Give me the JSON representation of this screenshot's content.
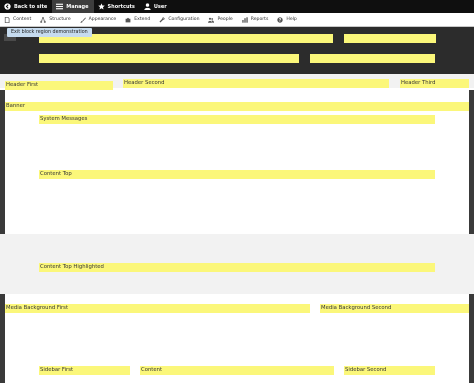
{
  "toolbar": {
    "items": [
      {
        "label": "Back to site",
        "icon": "back-arrow-icon"
      },
      {
        "label": "Manage",
        "icon": "hamburger-menu-icon"
      },
      {
        "label": "Shortcuts",
        "icon": "star-icon"
      },
      {
        "label": "User",
        "icon": "user-icon"
      }
    ]
  },
  "admin_menu": {
    "items": [
      {
        "label": "Content",
        "icon": "document-icon"
      },
      {
        "label": "Structure",
        "icon": "sitemap-icon"
      },
      {
        "label": "Appearance",
        "icon": "paintbrush-icon"
      },
      {
        "label": "Extend",
        "icon": "puzzle-icon"
      },
      {
        "label": "Configuration",
        "icon": "wrench-icon"
      },
      {
        "label": "People",
        "icon": "people-icon"
      },
      {
        "label": "Reports",
        "icon": "bar-chart-icon"
      },
      {
        "label": "Help",
        "icon": "help-icon"
      }
    ]
  },
  "tooltip": {
    "label": "Exit block region demonstration"
  },
  "regions": {
    "header_first": "Header First",
    "header_second": "Header Second",
    "header_third": "Header Third",
    "banner": "Banner",
    "system_messages": "System Messages",
    "content_top": "Content Top",
    "content_top_highlighted": "Content Top Highlighted",
    "media_background_first": "Media Background First",
    "media_background_second": "Media Background Second",
    "sidebar_first": "Sidebar First",
    "content": "Content",
    "sidebar_second": "Sidebar Second"
  },
  "colors": {
    "region_highlight": "#fbf77a",
    "toolbar_bg": "#0f0f0f",
    "dark_header_bg": "#2c2c2c",
    "light_band_bg": "#f2f2f2",
    "tooltip_bg": "#c6dbef"
  }
}
